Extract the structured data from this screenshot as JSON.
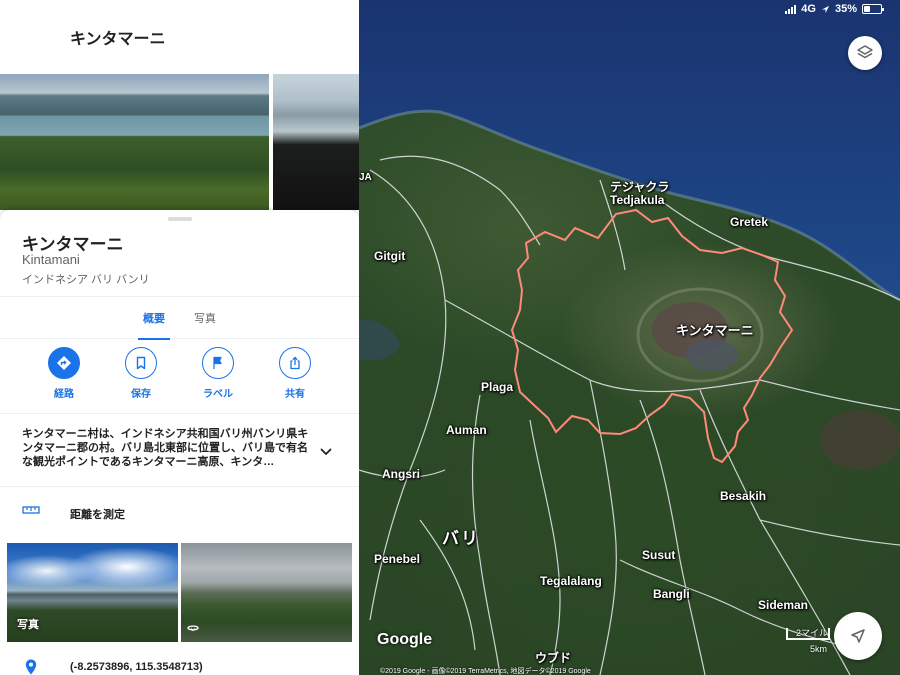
{
  "status_bar": {
    "network": "4G",
    "battery": "35%",
    "battery_level": 0.35,
    "icons": [
      "signal-icon",
      "location-arrow-icon",
      "battery-icon"
    ]
  },
  "panel": {
    "header_title": "キンタマーニ",
    "place": {
      "title": "キンタマーニ",
      "romanized": "Kintamani",
      "address": "インドネシア バリ バンリ"
    },
    "tabs": [
      {
        "label": "概要",
        "active": true
      },
      {
        "label": "写真",
        "active": false
      }
    ],
    "actions": [
      {
        "label": "経路",
        "icon": "directions-icon"
      },
      {
        "label": "保存",
        "icon": "bookmark-icon"
      },
      {
        "label": "ラベル",
        "icon": "flag-icon"
      },
      {
        "label": "共有",
        "icon": "share-icon"
      }
    ],
    "description": "キンタマーニ村は、インドネシア共和国バリ州バンリ県キンタマーニ郡の村。バリ島北東部に位置し、バリ島で有名な観光ポイントであるキンタマーニ高原、キンタ…",
    "measure_label": "距離を測定",
    "photo_caption": "写真",
    "coordinates": "(-8.2573896, 115.3548713)"
  },
  "map": {
    "labels": {
      "tedjakula_jp": "テジャクラ",
      "tedjakula": "Tedjakula",
      "gretek": "Gretek",
      "gitgit": "Gitgit",
      "ja": "JA",
      "kintamani": "キンタマーニ",
      "plaga": "Plaga",
      "auman": "Auman",
      "angsri": "Angsri",
      "besakih": "Besakih",
      "bali": "バリ",
      "penebel": "Penebel",
      "susut": "Susut",
      "tegalalang": "Tegalalang",
      "bangli": "Bangli",
      "sideman": "Sideman",
      "ubud": "ウブド"
    },
    "google_logo": "Google",
    "attribution": "©2019 Google - 画像©2019 TerraMetrics, 地図データ©2019 Google",
    "scale_top": "2マイル",
    "scale_bottom": "5km",
    "colors": {
      "sea": "#1b3d7a",
      "land": "#2f4d2a",
      "boundary": "#e8776b",
      "accent": "#1a73e8"
    }
  }
}
